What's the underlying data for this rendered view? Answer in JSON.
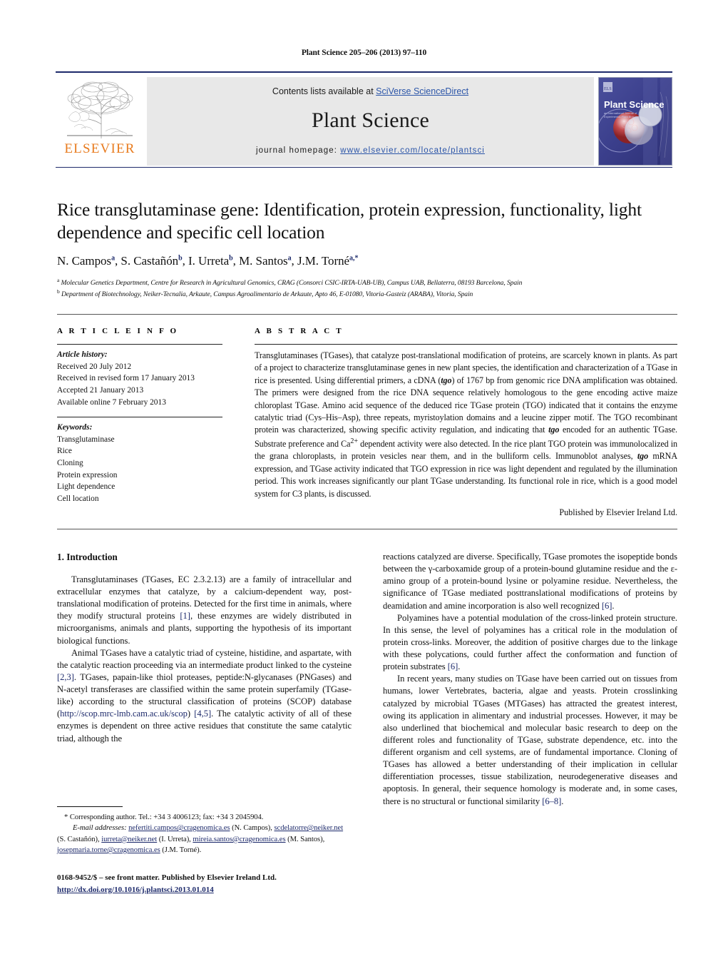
{
  "running_head": "Plant Science 205–206 (2013) 97–110",
  "banner": {
    "contents_prefix": "Contents lists available at ",
    "sciencedirect": "SciVerse ScienceDirect",
    "journal_title": "Plant Science",
    "homepage_prefix": "journal homepage: ",
    "homepage_url": "www.elsevier.com/locate/plantsci",
    "elsevier_wordmark": "ELSEVIER",
    "elsevier_color": "#e87b1e",
    "link_color": "#2b55a8",
    "rule_color": "#1d2a6b",
    "cover_title": "Plant Science"
  },
  "article": {
    "title": "Rice transglutaminase gene: Identification, protein expression, functionality, light dependence and specific cell location",
    "authors": [
      {
        "name": "N. Campos",
        "sup": "a"
      },
      {
        "name": "S. Castañón",
        "sup": "b"
      },
      {
        "name": "I. Urreta",
        "sup": "b"
      },
      {
        "name": "M. Santos",
        "sup": "a"
      },
      {
        "name": "J.M. Torné",
        "sup": "a,*"
      }
    ],
    "affiliations": [
      {
        "sup": "a",
        "text": "Molecular Genetics Department, Centre for Research in Agricultural Genomics, CRAG (Consorci CSIC-IRTA-UAB-UB), Campus UAB, Bellaterra, 08193 Barcelona, Spain"
      },
      {
        "sup": "b",
        "text": "Department of Biotechnology, Neiker-Tecnalia, Arkaute, Campus Agroalimentario de Arkaute, Apto 46, E-01080, Vitoria-Gasteiz (ARABA), Vitoria, Spain"
      }
    ]
  },
  "article_info": {
    "heading": "A R T I C L E  I N F O",
    "history_label": "Article history:",
    "history": [
      "Received 20 July 2012",
      "Received in revised form 17 January 2013",
      "Accepted 21 January 2013",
      "Available online 7 February 2013"
    ],
    "keywords_label": "Keywords:",
    "keywords": [
      "Transglutaminase",
      "Rice",
      "Cloning",
      "Protein expression",
      "Light dependence",
      "Cell location"
    ]
  },
  "abstract": {
    "heading": "A B S T R A C T",
    "paragraph_1": "Transglutaminases (TGases), that catalyze post-translational modification of proteins, are scarcely known in plants. As part of a project to characterize transglutaminase genes in new plant species, the identification and characterization of a TGase in rice is presented. Using differential primers, a cDNA (",
    "gene_italic_1": "tgo",
    "paragraph_2": ") of 1767 bp from genomic rice DNA amplification was obtained. The primers were designed from the rice DNA sequence relatively homologous to the gene encoding active maize chloroplast TGase. Amino acid sequence of the deduced rice TGase protein (TGO) indicated that it contains the enzyme catalytic triad (Cys–His–Asp), three repeats, myristoylation domains and a leucine zipper motif. The TGO recombinant protein was characterized, showing specific activity regulation, and indicating that ",
    "gene_italic_2": "tgo",
    "paragraph_3": " encoded for an authentic TGase. Substrate preference and Ca",
    "sup_2plus": "2+",
    "paragraph_4": " dependent activity were also detected. In the rice plant TGO protein was immunolocalized in the grana chloroplasts, in protein vesicles near them, and in the bulliform cells. Immunoblot analyses, ",
    "gene_italic_3": "tgo",
    "paragraph_5": " mRNA expression, and TGase activity indicated that TGO expression in rice was light dependent and regulated by the illumination period. This work increases significantly our plant TGase understanding. Its functional role in rice, which is a good model system for C3 plants, is discussed.",
    "publisher_line": "Published by Elsevier Ireland Ltd."
  },
  "introduction": {
    "heading": "1.  Introduction",
    "left_paragraphs": [
      {
        "seg1": "Transglutaminases (TGases, EC 2.3.2.13) are a family of intracellular and extracellular enzymes that catalyze, by a calcium-dependent way, post-translational modification of proteins. Detected for the first time in animals, where they modify structural proteins ",
        "ref1": "[1]",
        "seg2": ", these enzymes are widely distributed in microorganisms, animals and plants, supporting the hypothesis of its important biological functions."
      },
      {
        "seg1": "Animal TGases have a catalytic triad of cysteine, histidine, and aspartate, with the catalytic reaction proceeding via an intermediate product linked to the cysteine ",
        "ref1": "[2,3]",
        "seg2": ". TGases, papain-like thiol proteases, peptide:N-glycanases (PNGases) and N-acetyl transferases are classified within the same protein superfamily (TGase-like) according to the structural classification of proteins (SCOP) database (",
        "url": "http://scop.mrc-lmb.cam.ac.uk/scop",
        "seg3": ") ",
        "ref2": "[4,5]",
        "seg4": ". The catalytic activity of all of these enzymes is dependent on three active residues that constitute the same catalytic triad, although the"
      }
    ],
    "right_paragraphs": [
      {
        "seg1": "reactions catalyzed are diverse. Specifically, TGase promotes the isopeptide bonds between the γ-carboxamide group of a protein-bound glutamine residue and the ε-amino group of a protein-bound lysine or polyamine residue. Nevertheless, the significance of TGase mediated posttranslational modifications of proteins by deamidation and amine incorporation is also well recognized ",
        "ref1": "[6]",
        "seg2": "."
      },
      {
        "seg1": "Polyamines have a potential modulation of the cross-linked protein structure. In this sense, the level of polyamines has a critical role in the modulation of protein cross-links. Moreover, the addition of positive charges due to the linkage with these polycations, could further affect the conformation and function of protein substrates ",
        "ref1": "[6]",
        "seg2": "."
      },
      {
        "seg1": "In recent years, many studies on TGase have been carried out on tissues from humans, lower Vertebrates, bacteria, algae and yeasts. Protein crosslinking catalyzed by microbial TGases (MTGases) has attracted the greatest interest, owing its application in alimentary and industrial processes. However, it may be also underlined that biochemical and molecular basic research to deep on the different roles and functionality of TGase, substrate dependence, etc. into the different organism and cell systems, are of fundamental importance. Cloning of TGases has allowed a better understanding of their implication in cellular differentiation processes, tissue stabilization, neurodegenerative diseases and apoptosis. In general, their sequence homology is moderate and, in some cases, there is no structural or functional similarity ",
        "ref1": "[6–8]",
        "seg2": "."
      }
    ]
  },
  "footnote": {
    "corresponding": "* Corresponding author. Tel.: +34 3 4006123; fax: +34 3 2045904.",
    "email_label": "E-mail addresses:",
    "emails": [
      {
        "address": "nefertiti.campos@cragenomica.es",
        "person": " (N. Campos), "
      },
      {
        "address": "scdelatorre@neiker.net",
        "person": " (S. Castañón), "
      },
      {
        "address": "iurreta@neiker.net",
        "person": " (I. Urreta), "
      },
      {
        "address": "mireia.santos@cragenomica.es",
        "person": " (M. Santos), "
      },
      {
        "address": "josepmaria.torne@cragenomica.es",
        "person": " (J.M. Torné)."
      }
    ],
    "frontmatter": "0168-9452/$ – see front matter. Published by Elsevier Ireland Ltd.",
    "doi": "http://dx.doi.org/10.1016/j.plantsci.2013.01.014"
  }
}
